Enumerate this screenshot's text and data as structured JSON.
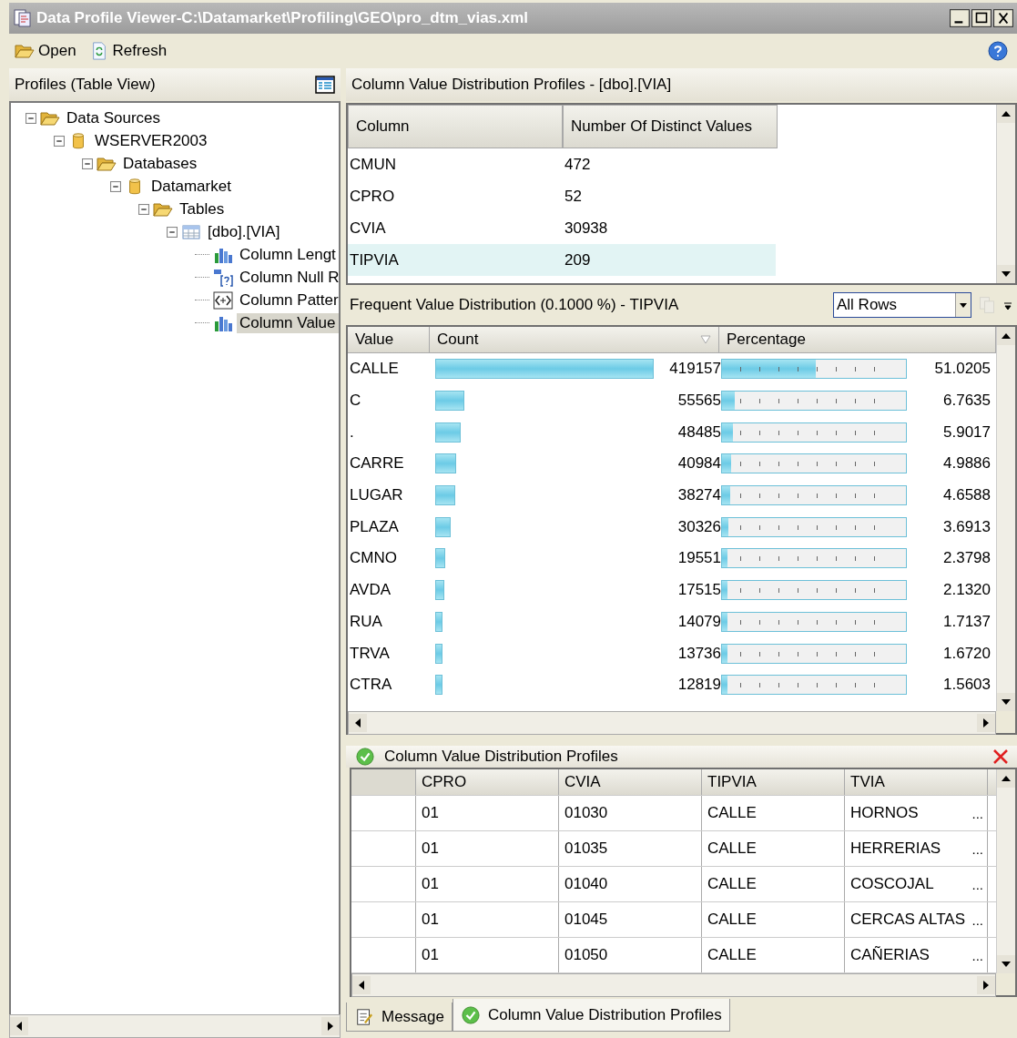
{
  "window": {
    "title": "Data Profile Viewer-C:\\Datamarket\\Profiling\\GEO\\pro_dtm_vias.xml"
  },
  "toolbar": [
    {
      "kind": "open",
      "label": "Open"
    },
    {
      "kind": "refresh",
      "label": "Refresh"
    }
  ],
  "profiles_pane": {
    "title": "Profiles (Table View)",
    "tree": [
      {
        "label": "Data Sources",
        "kind": "folder",
        "expanded": true,
        "selected": false,
        "children": [
          {
            "label": "WSERVER2003",
            "kind": "database",
            "expanded": true,
            "selected": false,
            "children": [
              {
                "label": "Databases",
                "kind": "folder",
                "expanded": true,
                "selected": false,
                "children": [
                  {
                    "label": "Datamarket",
                    "kind": "database",
                    "expanded": true,
                    "selected": false,
                    "children": [
                      {
                        "label": "Tables",
                        "kind": "folder",
                        "expanded": true,
                        "selected": false,
                        "children": [
                          {
                            "label": "[dbo].[VIA]",
                            "kind": "table",
                            "expanded": true,
                            "selected": false,
                            "children": [
                              {
                                "label": "Column Lengt",
                                "kind": "chart",
                                "selected": false
                              },
                              {
                                "label": "Column Null R",
                                "kind": "null",
                                "selected": false
                              },
                              {
                                "label": "Column Patter",
                                "kind": "pattern",
                                "selected": false
                              },
                              {
                                "label": "Column Value",
                                "kind": "chart",
                                "selected": true
                              }
                            ]
                          }
                        ]
                      }
                    ]
                  }
                ]
              }
            ]
          }
        ]
      }
    ]
  },
  "profile_view": {
    "title": "Column Value Distribution Profiles  -  [dbo].[VIA]",
    "columns": [
      "Column",
      "Number Of Distinct Values"
    ],
    "rows": [
      {
        "column": "CMUN",
        "distinct": "472",
        "selected": false
      },
      {
        "column": "CPRO",
        "distinct": "52",
        "selected": false
      },
      {
        "column": "CVIA",
        "distinct": "30938",
        "selected": false
      },
      {
        "column": "TIPVIA",
        "distinct": "209",
        "selected": true
      }
    ]
  },
  "distribution": {
    "title": "Frequent Value Distribution (0.1000 %) - TIPVIA",
    "filter": "All Rows",
    "columns": [
      "Value",
      "Count",
      "Percentage"
    ],
    "rows": [
      {
        "value": "CALLE",
        "count": "419157",
        "percentage": "51.0205",
        "level": 0.510205
      },
      {
        "value": "C",
        "count": "55565",
        "percentage": "6.7635",
        "level": 0.067635
      },
      {
        "value": ".",
        "count": "48485",
        "percentage": "5.9017",
        "level": 0.059017
      },
      {
        "value": "CARRE",
        "count": "40984",
        "percentage": "4.9886",
        "level": 0.049886
      },
      {
        "value": "LUGAR",
        "count": "38274",
        "percentage": "4.6588",
        "level": 0.046588
      },
      {
        "value": "PLAZA",
        "count": "30326",
        "percentage": "3.6913",
        "level": 0.036913
      },
      {
        "value": "CMNO",
        "count": "19551",
        "percentage": "2.3798",
        "level": 0.023798
      },
      {
        "value": "AVDA",
        "count": "17515",
        "percentage": "2.1320",
        "level": 0.02132
      },
      {
        "value": "RUA",
        "count": "14079",
        "percentage": "1.7137",
        "level": 0.017137
      },
      {
        "value": "TRVA",
        "count": "13736",
        "percentage": "1.6720",
        "level": 0.01672
      },
      {
        "value": "CTRA",
        "count": "12819",
        "percentage": "1.5603",
        "level": 0.015603
      }
    ]
  },
  "drilldown": {
    "title": "Column Value Distribution Profiles",
    "columns": [
      "CPRO",
      "CVIA",
      "TIPVIA",
      "TVIA"
    ],
    "rows": [
      {
        "cells": [
          "01",
          "01030",
          "CALLE",
          "HORNOS"
        ],
        "more": "..."
      },
      {
        "cells": [
          "01",
          "01035",
          "CALLE",
          "HERRERIAS"
        ],
        "more": "..."
      },
      {
        "cells": [
          "01",
          "01040",
          "CALLE",
          "COSCOJAL"
        ],
        "more": "..."
      },
      {
        "cells": [
          "01",
          "01045",
          "CALLE",
          "CERCAS ALTAS"
        ],
        "more": "..."
      },
      {
        "cells": [
          "01",
          "01050",
          "CALLE",
          "CAÑERIAS"
        ],
        "more": "..."
      }
    ]
  },
  "tabs": [
    {
      "label": "Message",
      "kind": "message",
      "selected": false
    },
    {
      "label": "Column Value Distribution Profiles",
      "kind": "success",
      "selected": true
    }
  ]
}
